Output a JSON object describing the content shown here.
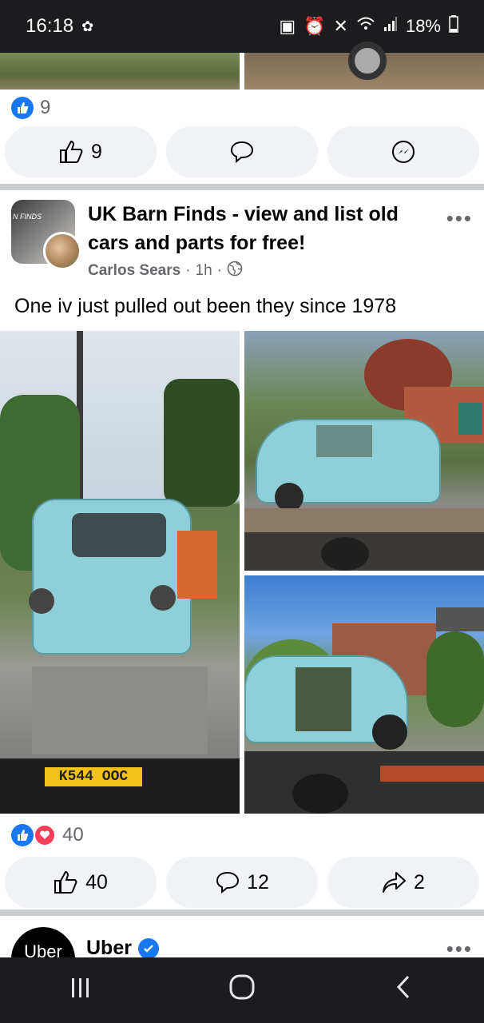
{
  "status_bar": {
    "time": "16:18",
    "battery": "18%"
  },
  "previous_post": {
    "reaction_count": "9",
    "like_count": "9"
  },
  "post": {
    "group_name": "UK Barn Finds - view and list old cars and parts for free!",
    "avatar_text": "N FINDS",
    "author": "Carlos Sears",
    "time_ago": "1h",
    "separator": "·",
    "text": "One iv just pulled out been they since 1978",
    "plate_text": "K544 OOC",
    "reaction_count": "40",
    "like_count": "40",
    "comment_count": "12",
    "share_count": "2",
    "more_label": "•••"
  },
  "next_post": {
    "name": "Uber",
    "avatar_text": "Uber",
    "more_label": "•••"
  },
  "nav": {
    "recents": "|||",
    "home": "O",
    "back": "<"
  },
  "colors": {
    "accent": "#1877f2",
    "heart": "#f33e58",
    "status_bg": "#1c1c1e"
  }
}
